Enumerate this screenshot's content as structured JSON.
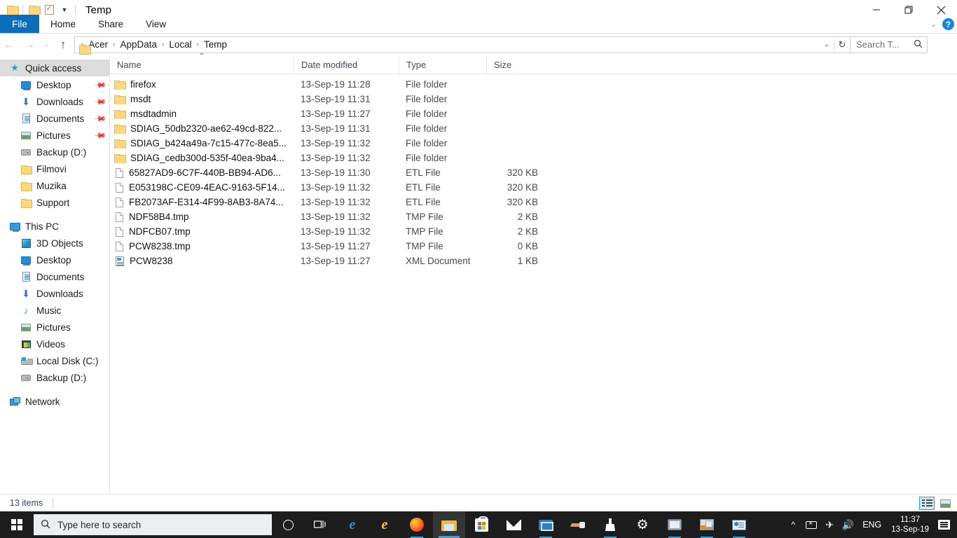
{
  "window": {
    "title": "Temp",
    "quick_access_toolbar": [
      {
        "name": "folder-properties-icon",
        "label": ""
      },
      {
        "name": "new-folder-icon",
        "label": ""
      },
      {
        "name": "properties-checkbox-icon",
        "label": ""
      },
      {
        "name": "customize-qat-caret-icon",
        "label": "▾"
      }
    ],
    "controls": {
      "minimize": "minimize-icon",
      "maximize": "restore-icon",
      "close": "close-icon"
    }
  },
  "ribbon": {
    "tabs": [
      {
        "label": "File",
        "active": true
      },
      {
        "label": "Home",
        "active": false
      },
      {
        "label": "Share",
        "active": false
      },
      {
        "label": "View",
        "active": false
      }
    ],
    "expand_caret": "⌄",
    "help_label": "?"
  },
  "address": {
    "back_arrow": "←",
    "forward_arrow": "→",
    "recent_caret": "⌄",
    "up_arrow": "↑",
    "separator": "›",
    "breadcrumbs": [
      "Acer",
      "AppData",
      "Local",
      "Temp"
    ],
    "dropdown_caret": "⌄",
    "refresh_glyph": "↻"
  },
  "search": {
    "placeholder": "Search T...",
    "icon": "search-icon"
  },
  "navpane": {
    "groups": [
      {
        "header": {
          "label": "Quick access",
          "icon": "star-pin-icon",
          "selected": true
        },
        "items": [
          {
            "label": "Desktop",
            "icon": "monitor-icon",
            "pinned": true
          },
          {
            "label": "Downloads",
            "icon": "download-arrow-icon",
            "pinned": true
          },
          {
            "label": "Documents",
            "icon": "document-icon",
            "pinned": true
          },
          {
            "label": "Pictures",
            "icon": "picture-icon",
            "pinned": true
          },
          {
            "label": "Backup (D:)",
            "icon": "drive-icon",
            "pinned": false
          },
          {
            "label": "Filmovi",
            "icon": "folder-icon",
            "pinned": false
          },
          {
            "label": "Muzika",
            "icon": "folder-icon",
            "pinned": false
          },
          {
            "label": "Support",
            "icon": "folder-icon",
            "pinned": false
          }
        ]
      },
      {
        "header": {
          "label": "This PC",
          "icon": "this-pc-icon",
          "selected": false
        },
        "items": [
          {
            "label": "3D Objects",
            "icon": "3d-objects-icon",
            "pinned": false
          },
          {
            "label": "Desktop",
            "icon": "monitor-icon",
            "pinned": false
          },
          {
            "label": "Documents",
            "icon": "document-icon",
            "pinned": false
          },
          {
            "label": "Downloads",
            "icon": "download-arrow-icon",
            "pinned": false
          },
          {
            "label": "Music",
            "icon": "music-note-icon",
            "pinned": false
          },
          {
            "label": "Pictures",
            "icon": "picture-icon",
            "pinned": false
          },
          {
            "label": "Videos",
            "icon": "video-icon",
            "pinned": false
          },
          {
            "label": "Local Disk (C:)",
            "icon": "local-disk-icon",
            "pinned": false
          },
          {
            "label": "Backup (D:)",
            "icon": "drive-icon",
            "pinned": false
          }
        ]
      },
      {
        "header": {
          "label": "Network",
          "icon": "network-icon",
          "selected": false
        },
        "items": []
      }
    ]
  },
  "filelist": {
    "columns": [
      {
        "key": "name",
        "label": "Name",
        "sorted": "asc",
        "sort_glyph": "⌃"
      },
      {
        "key": "date",
        "label": "Date modified"
      },
      {
        "key": "type",
        "label": "Type"
      },
      {
        "key": "size",
        "label": "Size"
      }
    ],
    "rows": [
      {
        "name": "firefox",
        "date": "13-Sep-19 11:28",
        "type": "File folder",
        "size": "",
        "icon": "folder-icon"
      },
      {
        "name": "msdt",
        "date": "13-Sep-19 11:31",
        "type": "File folder",
        "size": "",
        "icon": "folder-icon"
      },
      {
        "name": "msdtadmin",
        "date": "13-Sep-19 11:27",
        "type": "File folder",
        "size": "",
        "icon": "folder-icon"
      },
      {
        "name": "SDIAG_50db2320-ae62-49cd-822...",
        "date": "13-Sep-19 11:31",
        "type": "File folder",
        "size": "",
        "icon": "folder-icon"
      },
      {
        "name": "SDIAG_b424a49a-7c15-477c-8ea5...",
        "date": "13-Sep-19 11:32",
        "type": "File folder",
        "size": "",
        "icon": "folder-icon"
      },
      {
        "name": "SDIAG_cedb300d-535f-40ea-9ba4...",
        "date": "13-Sep-19 11:32",
        "type": "File folder",
        "size": "",
        "icon": "folder-icon"
      },
      {
        "name": "65827AD9-6C7F-440B-BB94-AD6...",
        "date": "13-Sep-19 11:30",
        "type": "ETL File",
        "size": "320 KB",
        "icon": "file-icon"
      },
      {
        "name": "E053198C-CE09-4EAC-9163-5F14...",
        "date": "13-Sep-19 11:32",
        "type": "ETL File",
        "size": "320 KB",
        "icon": "file-icon"
      },
      {
        "name": "FB2073AF-E314-4F99-8AB3-8A74...",
        "date": "13-Sep-19 11:32",
        "type": "ETL File",
        "size": "320 KB",
        "icon": "file-icon"
      },
      {
        "name": "NDF58B4.tmp",
        "date": "13-Sep-19 11:32",
        "type": "TMP File",
        "size": "2 KB",
        "icon": "file-icon"
      },
      {
        "name": "NDFCB07.tmp",
        "date": "13-Sep-19 11:32",
        "type": "TMP File",
        "size": "2 KB",
        "icon": "file-icon"
      },
      {
        "name": "PCW8238.tmp",
        "date": "13-Sep-19 11:27",
        "type": "TMP File",
        "size": "0 KB",
        "icon": "file-icon"
      },
      {
        "name": "PCW8238",
        "date": "13-Sep-19 11:27",
        "type": "XML Document",
        "size": "1 KB",
        "icon": "xml-document-icon"
      }
    ]
  },
  "statusbar": {
    "item_count": "13 items",
    "view_buttons": [
      {
        "name": "details-view-button",
        "selected": true
      },
      {
        "name": "large-icons-view-button",
        "selected": false
      }
    ]
  },
  "taskbar": {
    "start_label": "",
    "search_placeholder": "Type here to search",
    "search_icon": "search-icon",
    "cortana_icon": "cortana-circle-icon",
    "task_view_icon": "task-view-icon",
    "apps": [
      {
        "name": "microsoft-edge-icon",
        "active": false,
        "running": false
      },
      {
        "name": "internet-explorer-icon",
        "active": false,
        "running": false
      },
      {
        "name": "firefox-icon",
        "active": false,
        "running": true
      },
      {
        "name": "file-explorer-icon",
        "active": true,
        "running": true
      },
      {
        "name": "microsoft-store-icon",
        "active": false,
        "running": false
      },
      {
        "name": "mail-icon",
        "active": false,
        "running": false
      },
      {
        "name": "sticky-notes-icon",
        "active": false,
        "running": true
      },
      {
        "name": "paint-brush-icon",
        "active": false,
        "running": false
      },
      {
        "name": "cleaner-icon",
        "active": false,
        "running": true
      },
      {
        "name": "settings-gear-icon",
        "active": false,
        "running": false
      },
      {
        "name": "system-monitor-icon",
        "active": false,
        "running": true
      },
      {
        "name": "photo-viewer-icon",
        "active": false,
        "running": true
      },
      {
        "name": "contacts-icon",
        "active": false,
        "running": true
      }
    ],
    "tray": {
      "show_hidden_icons": "chevron-up-icon",
      "battery": "battery-icon",
      "airplane": "airplane-mode-icon",
      "volume": "volume-icon",
      "language": "ENG",
      "time": "11:37",
      "date": "13-Sep-19",
      "action_center": "action-center-icon"
    }
  }
}
